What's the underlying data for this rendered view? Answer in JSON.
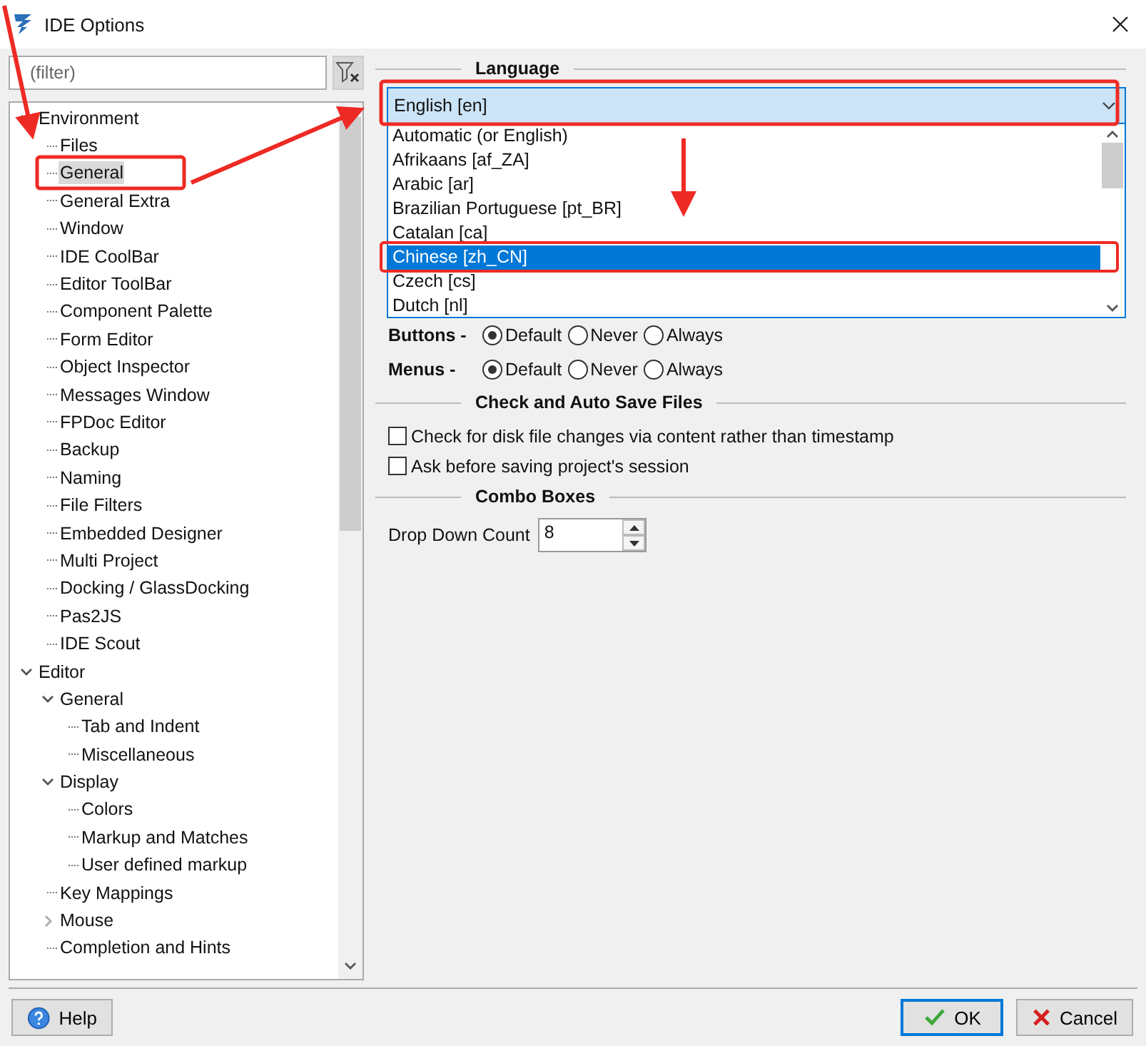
{
  "window": {
    "title": "IDE Options"
  },
  "filter": {
    "placeholder": "(filter)"
  },
  "tree": [
    {
      "label": "Environment",
      "expanded": true,
      "selected": false,
      "children": [
        {
          "label": "Files",
          "selected": false
        },
        {
          "label": "General",
          "selected": true
        },
        {
          "label": "General Extra",
          "selected": false
        },
        {
          "label": "Window",
          "selected": false
        },
        {
          "label": "IDE CoolBar",
          "selected": false
        },
        {
          "label": "Editor ToolBar",
          "selected": false
        },
        {
          "label": "Component Palette",
          "selected": false
        },
        {
          "label": "Form Editor",
          "selected": false
        },
        {
          "label": "Object Inspector",
          "selected": false
        },
        {
          "label": "Messages Window",
          "selected": false
        },
        {
          "label": "FPDoc Editor",
          "selected": false
        },
        {
          "label": "Backup",
          "selected": false
        },
        {
          "label": "Naming",
          "selected": false
        },
        {
          "label": "File Filters",
          "selected": false
        },
        {
          "label": "Embedded Designer",
          "selected": false
        },
        {
          "label": "Multi Project",
          "selected": false
        },
        {
          "label": "Docking / GlassDocking",
          "selected": false
        },
        {
          "label": "Pas2JS",
          "selected": false
        },
        {
          "label": "IDE Scout",
          "selected": false
        }
      ]
    },
    {
      "label": "Editor",
      "expanded": true,
      "selected": false,
      "children": [
        {
          "label": "General",
          "expanded": true,
          "selected": false,
          "children": [
            {
              "label": "Tab and Indent",
              "selected": false
            },
            {
              "label": "Miscellaneous",
              "selected": false
            }
          ]
        },
        {
          "label": "Display",
          "expanded": true,
          "selected": false,
          "children": [
            {
              "label": "Colors",
              "selected": false
            },
            {
              "label": "Markup and Matches",
              "selected": false
            },
            {
              "label": "User defined markup",
              "selected": false
            }
          ]
        },
        {
          "label": "Key Mappings",
          "selected": false
        },
        {
          "label": "Mouse",
          "expanded": false,
          "selected": false
        },
        {
          "label": "Completion and Hints",
          "selected": false
        }
      ]
    }
  ],
  "language": {
    "heading": "Language",
    "value": "English [en]",
    "options": [
      {
        "label": "Automatic (or English)",
        "selected": false
      },
      {
        "label": "Afrikaans [af_ZA]",
        "selected": false
      },
      {
        "label": "Arabic [ar]",
        "selected": false
      },
      {
        "label": "Brazilian Portuguese [pt_BR]",
        "selected": false
      },
      {
        "label": "Catalan [ca]",
        "selected": false
      },
      {
        "label": "Chinese [zh_CN]",
        "selected": true
      },
      {
        "label": "Czech [cs]",
        "selected": false
      },
      {
        "label": "Dutch [nl]",
        "selected": false
      }
    ]
  },
  "glyph_rows": [
    {
      "label": "Buttons -",
      "options": [
        {
          "label": "Default",
          "selected": true
        },
        {
          "label": "Never",
          "selected": false
        },
        {
          "label": "Always",
          "selected": false
        }
      ]
    },
    {
      "label": "Menus -",
      "options": [
        {
          "label": "Default",
          "selected": true
        },
        {
          "label": "Never",
          "selected": false
        },
        {
          "label": "Always",
          "selected": false
        }
      ]
    }
  ],
  "autosave": {
    "heading": "Check and Auto Save Files",
    "checks": [
      {
        "label": "Check for disk file changes via content rather than timestamp",
        "checked": false
      },
      {
        "label": "Ask before saving project's session",
        "checked": false
      }
    ]
  },
  "combo_boxes": {
    "heading": "Combo Boxes",
    "label": "Drop Down Count",
    "value": "8"
  },
  "buttons": {
    "help": "Help",
    "ok": "OK",
    "cancel": "Cancel"
  }
}
